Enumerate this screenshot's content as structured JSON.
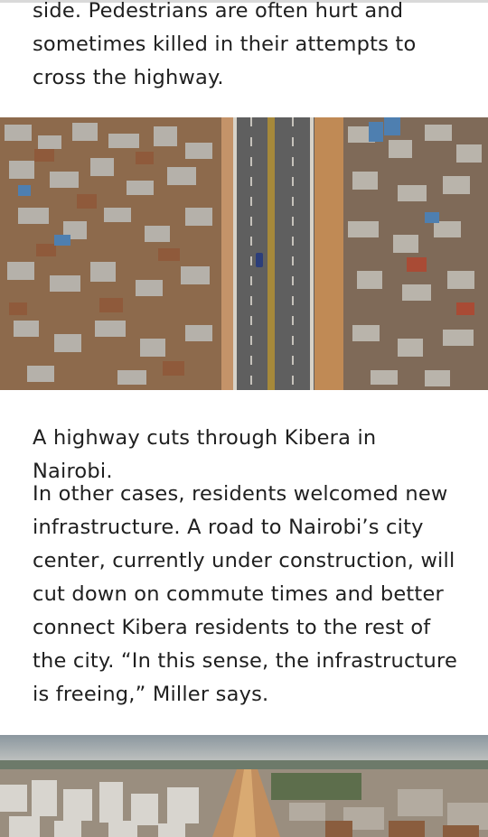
{
  "article": {
    "intro_paragraph": "side. Pedestrians are often hurt and sometimes killed in their attempts to cross the highway.",
    "image_caption": "A highway cuts through Kibera in Nairobi.",
    "body_paragraph": "In other cases, residents welcomed new infrastructure. A road to Nairobi’s city center, currently under construction, will cut down on commute times and better connect Kibera residents to the rest of the city. “In this sense, the infrastructure is freeing,” Miller says."
  },
  "colors": {
    "text": "#1f1f1f",
    "background": "#ffffff",
    "road": "#5f5f5f",
    "dirt": "#b7875d",
    "roof_tin": "#b9b4ab",
    "roof_rust": "#8f5a3b",
    "sky": "#9aa5ad"
  }
}
